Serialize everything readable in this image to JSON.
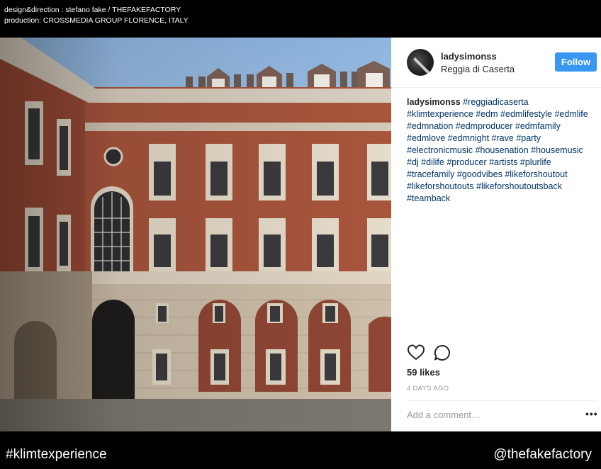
{
  "credits": {
    "line1": "design&direction : stefano fake / THEFAKEFACTORY",
    "line2": "production: CROSSMEDIA GROUP FLORENCE, ITALY"
  },
  "post": {
    "username": "ladysimonss",
    "location": "Reggia di Caserta",
    "follow_label": "Follow",
    "caption_user": "ladysimonss",
    "hashtags": [
      "#reggiadicaserta",
      "#klimtexperience",
      "#edm",
      "#edmlifestyle",
      "#edmlife",
      "#edmnation",
      "#edmproducer",
      "#edmfamily",
      "#edmlove",
      "#edmnight",
      "#rave",
      "#party",
      "#electronicmusic",
      "#housenation",
      "#housemusic",
      "#dj",
      "#dilife",
      "#producer",
      "#artists",
      "#plurlife",
      "#tracefamily",
      "#goodvibes",
      "#likeforshoutout",
      "#likeforshoutouts",
      "#likeforshoutoutsback",
      "#teamback"
    ],
    "likes": "59 likes",
    "time_ago": "4 DAYS AGO",
    "comment_placeholder": "Add a comment…",
    "more_label": "•••",
    "icons": {
      "like": "heart-icon",
      "comment": "comment-icon",
      "more": "more-options-icon"
    },
    "colors": {
      "follow_button": "#3897f0",
      "hashtag": "#003569"
    }
  },
  "footer": {
    "left": "#klimtexperience",
    "right": "@thefakefactory"
  }
}
